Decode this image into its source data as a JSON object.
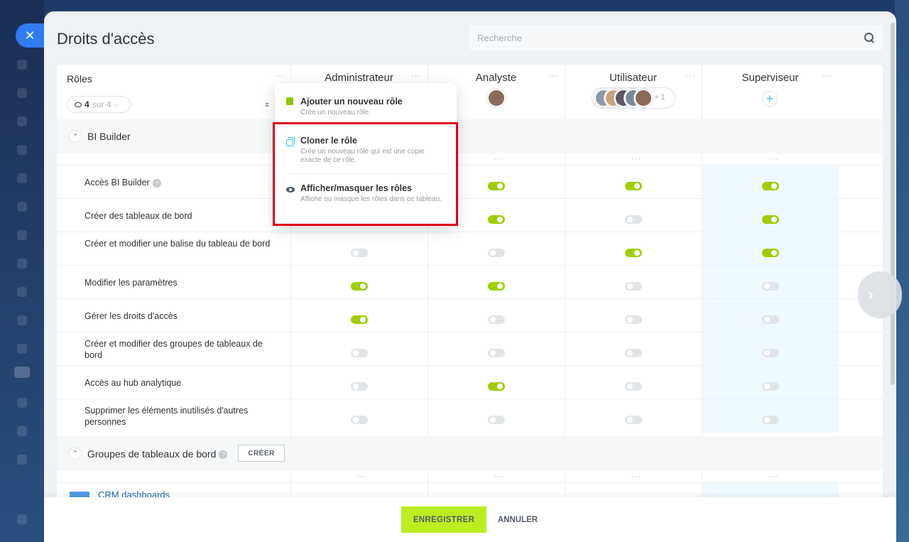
{
  "panel": {
    "title": "Droits d'accès",
    "search_placeholder": "Recherche"
  },
  "roles_header": {
    "label": "Rôles",
    "counter_value": "4",
    "counter_suffix": "sur 4"
  },
  "columns": [
    {
      "name": "Administrateur"
    },
    {
      "name": "Analyste"
    },
    {
      "name": "Utilisateur",
      "extra_members": "+ 1"
    },
    {
      "name": "Superviseur"
    }
  ],
  "popup": {
    "items": [
      {
        "title": "Ajouter un nouveau rôle",
        "desc": "Crée un nouveau rôle."
      },
      {
        "title": "Cloner le rôle",
        "desc": "Crée un nouveau rôle qui est une copie exacte de ce rôle."
      },
      {
        "title": "Afficher/masquer les rôles",
        "desc": "Affiche ou masque les rôles dans ce tableau."
      }
    ]
  },
  "sections": [
    {
      "title": "BI Builder"
    },
    {
      "title": "Groupes de tableaux de bord",
      "button": "CRÉER"
    }
  ],
  "permissions": [
    {
      "label": "Accès BI Builder",
      "help": true,
      "values": [
        null,
        true,
        true,
        true
      ]
    },
    {
      "label": "Créer des tableaux de bord",
      "values": [
        null,
        true,
        false,
        true
      ]
    },
    {
      "label": "Créer et modifier une balise du tableau de bord",
      "values": [
        false,
        false,
        true,
        true
      ]
    },
    {
      "label": "Modifier les paramètres",
      "values": [
        true,
        true,
        false,
        false
      ]
    },
    {
      "label": "Gérer les droits d'accès",
      "values": [
        true,
        false,
        false,
        false
      ]
    },
    {
      "label": "Créer et modifier des groupes de tableaux de bord",
      "values": [
        false,
        false,
        false,
        false
      ]
    },
    {
      "label": "Accès au hub analytique",
      "values": [
        false,
        true,
        false,
        false
      ]
    },
    {
      "label": "Supprimer les éléments inutilisés d'autres personnes",
      "values": [
        false,
        false,
        false,
        false
      ]
    }
  ],
  "dashboard_group": {
    "name": "CRM dashboards"
  },
  "footer": {
    "save_label": "ENREGISTRER",
    "cancel_label": "ANNULER"
  },
  "colors": {
    "accent_blue": "#2f7bf5",
    "toggle_on": "#9dcf00",
    "save_button": "#bbed21",
    "highlight": "#e0001a"
  },
  "icons": [
    "close-icon",
    "search-icon",
    "eye-icon",
    "plus-icon",
    "copy-icon",
    "chevron-right-icon",
    "folder-icon",
    "help-icon"
  ]
}
